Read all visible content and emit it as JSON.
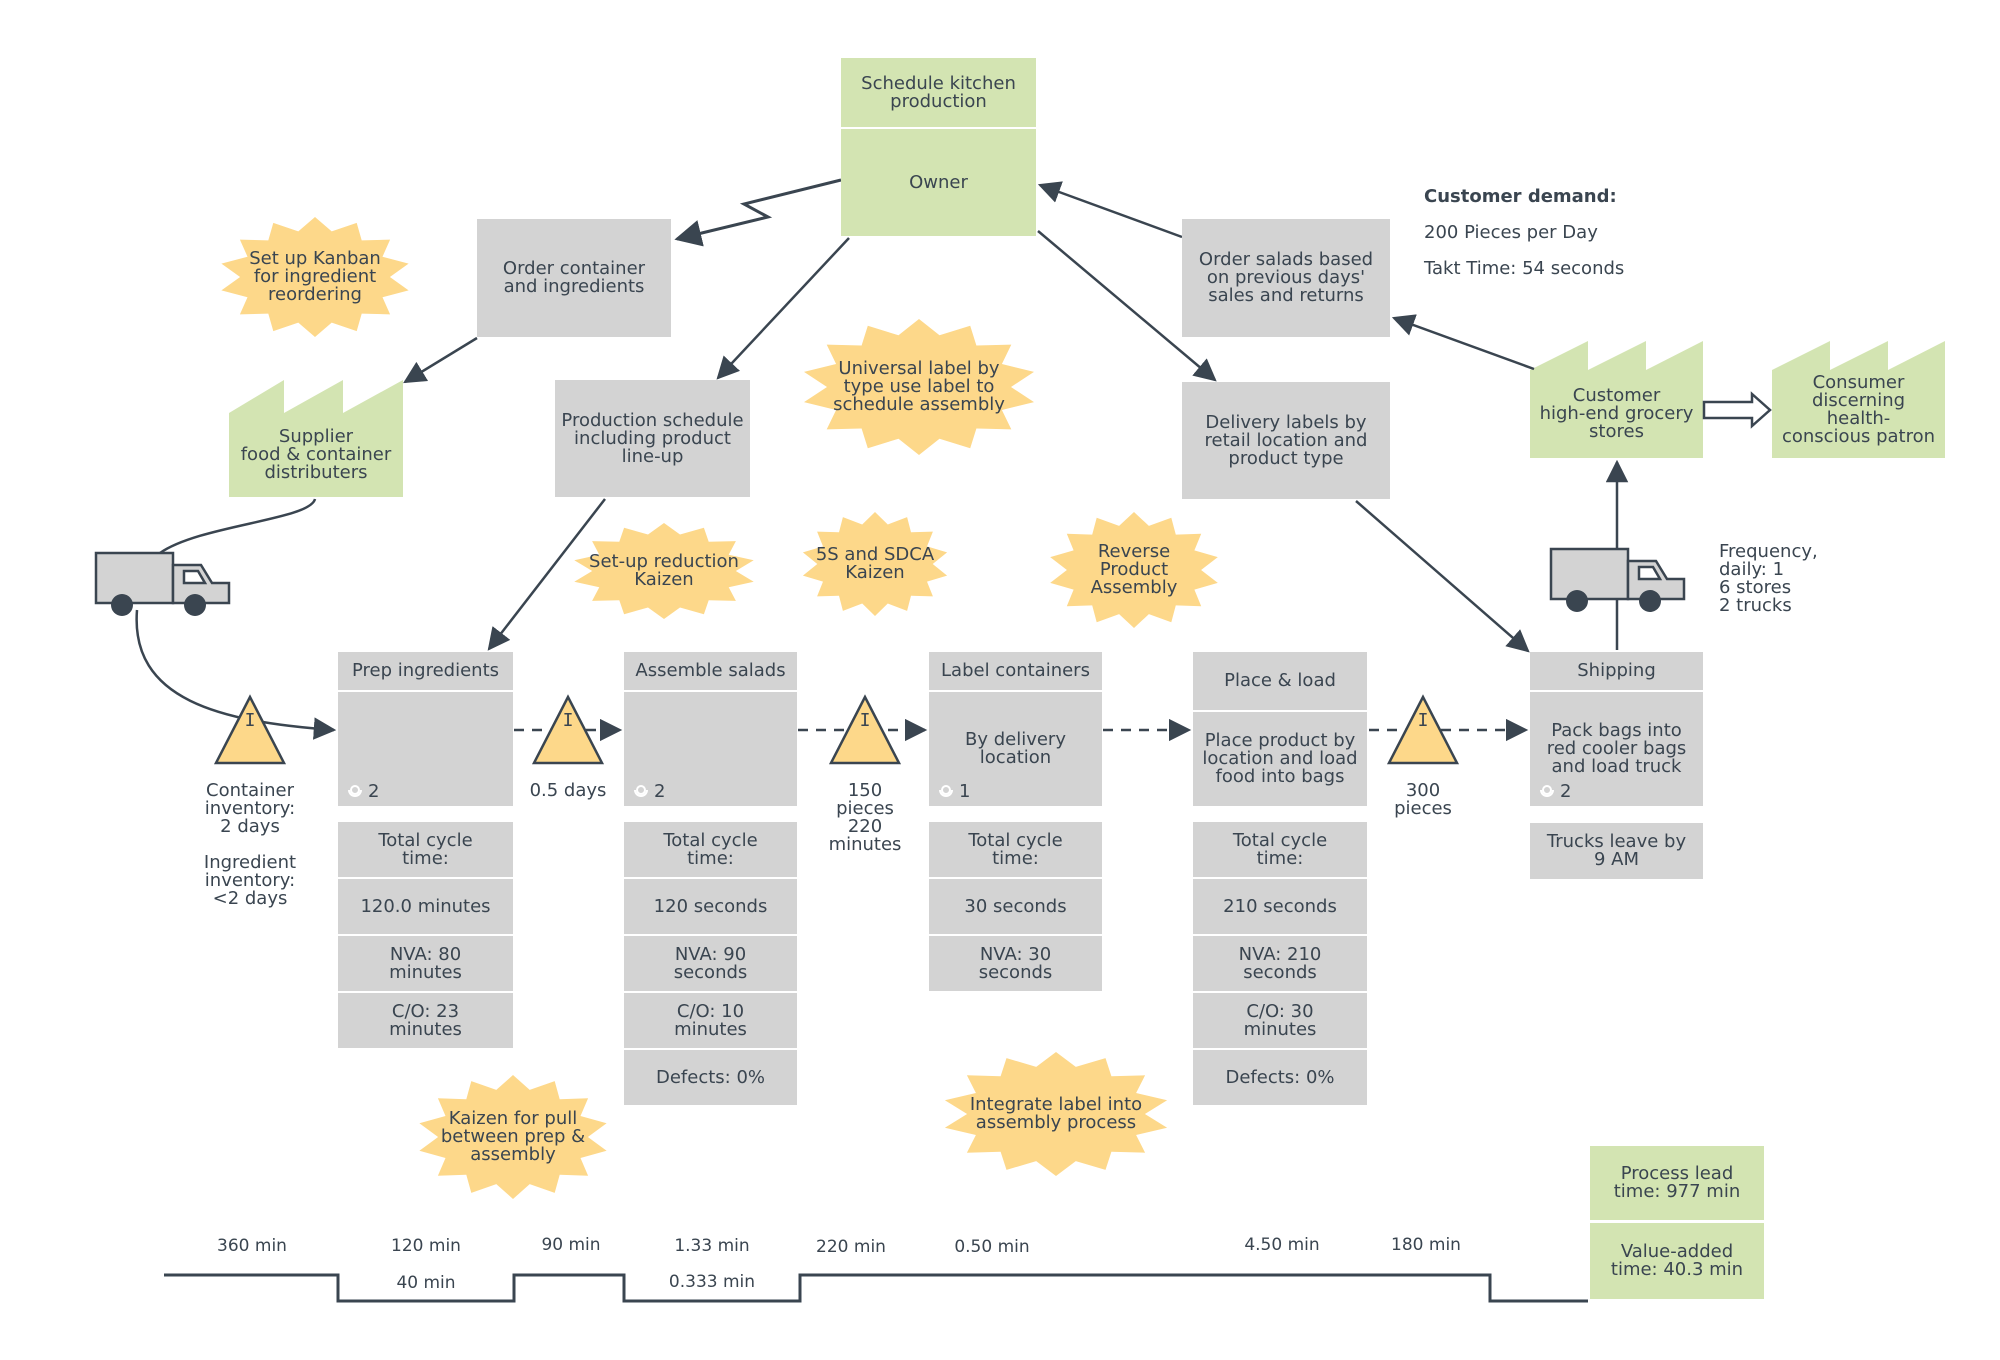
{
  "control": {
    "header": "Schedule kitchen\nproduction",
    "owner": "Owner"
  },
  "info_boxes": {
    "order_container": "Order container\nand ingredients",
    "production_schedule": "Production schedule\nincluding product\nline-up",
    "order_salads": "Order salads based\non previous days'\nsales and returns",
    "delivery_labels": "Delivery labels by\nretail location and\nproduct type"
  },
  "suppliers": {
    "supplier": "Supplier\nfood & container\ndistributers",
    "customer": "Customer\nhigh-end grocery\nstores",
    "consumer": "Consumer\ndiscerning\nhealth-\nconscious patron"
  },
  "customer_demand": {
    "title": "Customer demand:",
    "line1": "200 Pieces per Day",
    "line2": "Takt Time: 54 seconds"
  },
  "shipping_info": {
    "text": "Frequency,\ndaily: 1\n6 stores\n2 trucks"
  },
  "kaizen_bursts": [
    {
      "text": "Set up Kanban\nfor ingredient\nreordering"
    },
    {
      "text": "Universal label by\ntype use label to\nschedule assembly"
    },
    {
      "text": "Set-up reduction\nKaizen"
    },
    {
      "text": "5S and SDCA\nKaizen"
    },
    {
      "text": "Reverse\nProduct\nAssembly"
    },
    {
      "text": "Kaizen for pull\nbetween prep &\nassembly"
    },
    {
      "text": "Integrate label into\nassembly process"
    }
  ],
  "processes": [
    {
      "name": "Prep ingredients",
      "body": "",
      "operators": "2",
      "metrics": [
        "Total cycle\ntime:",
        "120.0 minutes",
        "NVA: 80\nminutes",
        "C/O: 23\nminutes"
      ]
    },
    {
      "name": "Assemble salads",
      "body": "",
      "operators": "2",
      "metrics": [
        "Total cycle\ntime:",
        "120 seconds",
        "NVA: 90\nseconds",
        "C/O: 10\nminutes",
        "Defects: 0%"
      ]
    },
    {
      "name": "Label containers",
      "body": "By delivery\nlocation",
      "operators": "1",
      "metrics": [
        "Total cycle\ntime:",
        "30 seconds",
        "NVA: 30\nseconds"
      ]
    },
    {
      "name": "Place & load",
      "body": "Place product by\nlocation and load\nfood into bags",
      "operators": "",
      "metrics": [
        "Total cycle\ntime:",
        "210 seconds",
        "NVA: 210\nseconds",
        "C/O: 30\nminutes",
        "Defects: 0%"
      ]
    },
    {
      "name": "Shipping",
      "body": "Pack bags into\nred cooler bags\nand load truck",
      "operators": "2",
      "metrics": [
        "Trucks leave by\n9 AM"
      ]
    }
  ],
  "inventories": [
    {
      "symbol": "I",
      "label": "Container\ninventory:\n2 days\n\nIngredient\ninventory:\n<2 days"
    },
    {
      "symbol": "I",
      "label": "0.5 days"
    },
    {
      "symbol": "I",
      "label": "150\npieces\n220\nminutes"
    },
    {
      "symbol": "I",
      "label": "300\npieces"
    }
  ],
  "timeline": {
    "waiting": [
      "360 min",
      "90 min",
      "220 min",
      "180 min"
    ],
    "process_top": [
      "120 min",
      "1.33 min",
      "0.50 min",
      "4.50 min"
    ],
    "process_bottom": [
      "40 min",
      "0.333 min"
    ]
  },
  "summary": {
    "lead_time": "Process lead\ntime: 977 min",
    "value_added": "Value-added\ntime: 40.3 min"
  },
  "colors": {
    "green": "#d3e4b2",
    "gray": "#d3d3d3",
    "yellow": "#fdd88a",
    "ink": "#3a4550"
  }
}
